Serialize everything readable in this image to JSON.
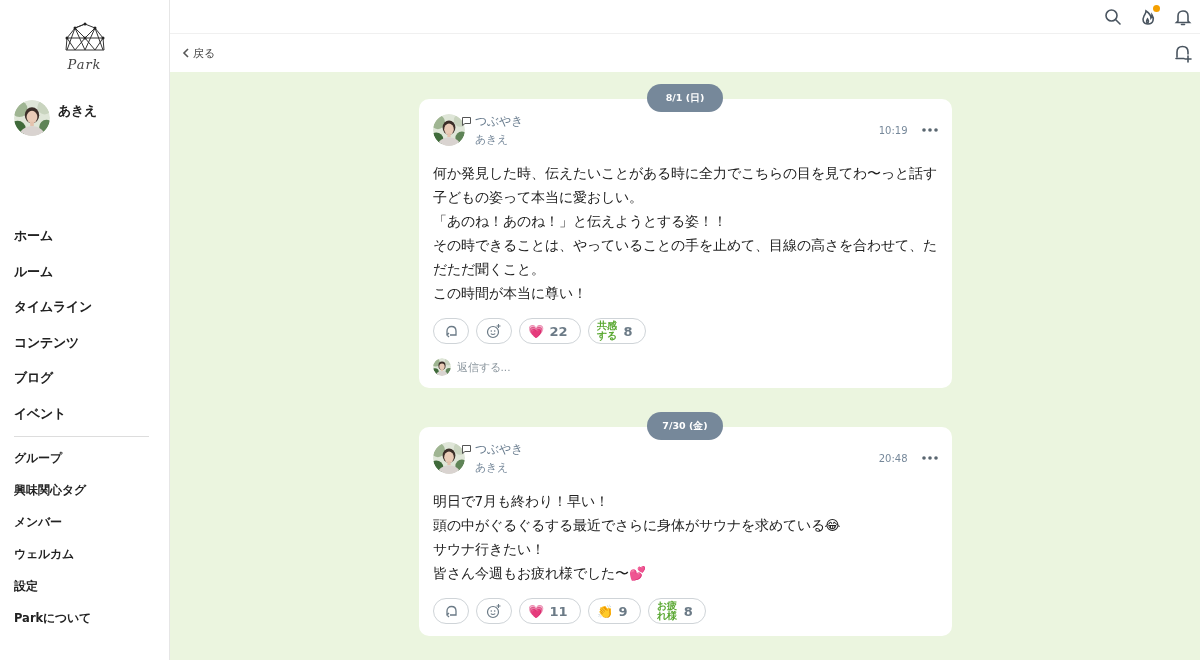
{
  "sidebar": {
    "logo_text": "Park",
    "user": {
      "name": "あきえ"
    },
    "main_nav": [
      {
        "label": "ホーム"
      },
      {
        "label": "ルーム"
      },
      {
        "label": "タイムライン"
      },
      {
        "label": "コンテンツ"
      },
      {
        "label": "ブログ"
      },
      {
        "label": "イベント"
      }
    ],
    "sub_nav": [
      {
        "label": "グループ"
      },
      {
        "label": "興味関心タグ"
      },
      {
        "label": "メンバー"
      },
      {
        "label": "ウェルカム"
      },
      {
        "label": "設定"
      },
      {
        "label": "Parkについて"
      }
    ]
  },
  "header": {
    "notification_dot": true,
    "back_label": "戻る"
  },
  "feed": [
    {
      "date": "8/1 (日)",
      "post": {
        "type": "つぶやき",
        "author": "あきえ",
        "time": "10:19",
        "lines": [
          "何か発見した時、伝えたいことがある時に全力でこちらの目を見てわ〜っと話す子どもの姿って本当に愛おしい。",
          "「あのね！あのね！」と伝えようとする姿！！",
          "その時できることは、やっていることの手を止めて、目線の高さを合わせて、ただただ聞くこと。",
          "この時間が本当に尊い！"
        ],
        "reactions": [
          {
            "kind": "reply"
          },
          {
            "kind": "add"
          },
          {
            "kind": "emoji",
            "emoji": "💗",
            "count": "22"
          },
          {
            "kind": "stamp",
            "stamp": "共感する",
            "count": "8"
          }
        ],
        "reply_placeholder": "返信する..."
      }
    },
    {
      "date": "7/30 (金)",
      "post": {
        "type": "つぶやき",
        "author": "あきえ",
        "time": "20:48",
        "lines": [
          "明日で7月も終わり！早い！",
          "頭の中がぐるぐるする最近でさらに身体がサウナを求めている😂",
          "サウナ行きたい！",
          "皆さん今週もお疲れ様でした〜💕"
        ],
        "reactions": [
          {
            "kind": "reply"
          },
          {
            "kind": "add"
          },
          {
            "kind": "emoji",
            "emoji": "💗",
            "count": "11"
          },
          {
            "kind": "emoji",
            "emoji": "👏",
            "count": "9"
          },
          {
            "kind": "stamp",
            "stamp": "お疲れ様",
            "count": "8"
          }
        ]
      }
    }
  ]
}
